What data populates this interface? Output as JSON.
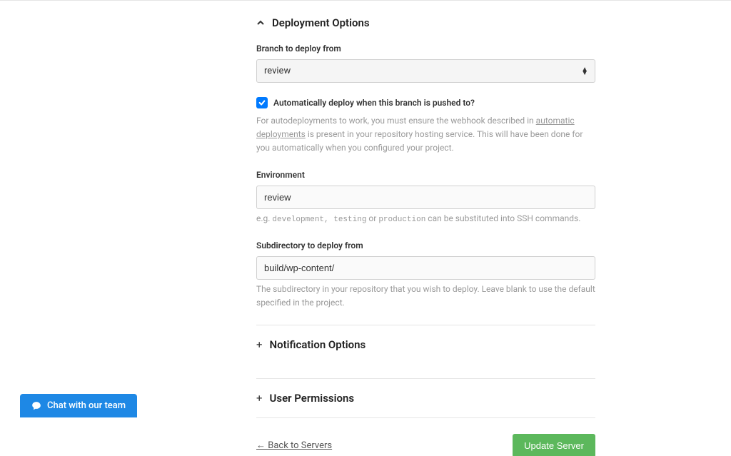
{
  "sections": {
    "deployment": {
      "title": "Deployment Options",
      "branch": {
        "label": "Branch to deploy from",
        "value": "review"
      },
      "autodeploy": {
        "checkbox_label": "Automatically deploy when this branch is pushed to?",
        "help_prefix": "For autodeployments to work, you must ensure the webhook described in ",
        "help_link": "automatic deployments",
        "help_suffix": " is present in your repository hosting service. This will have been done for you automatically when you configured your project."
      },
      "environment": {
        "label": "Environment",
        "value": "review",
        "help_prefix": "e.g. ",
        "help_code": "development, testing",
        "help_mid": " or ",
        "help_code2": "production",
        "help_suffix": " can be substituted into SSH commands."
      },
      "subdirectory": {
        "label": "Subdirectory to deploy from",
        "value": "build/wp-content/",
        "help": "The subdirectory in your repository that you wish to deploy. Leave blank to use the default specified in the project."
      }
    },
    "notification": {
      "title": "Notification Options"
    },
    "permissions": {
      "title": "User Permissions"
    }
  },
  "footer": {
    "back_link": "← Back to Servers",
    "submit_label": "Update Server"
  },
  "chat": {
    "label": "Chat with our team"
  }
}
